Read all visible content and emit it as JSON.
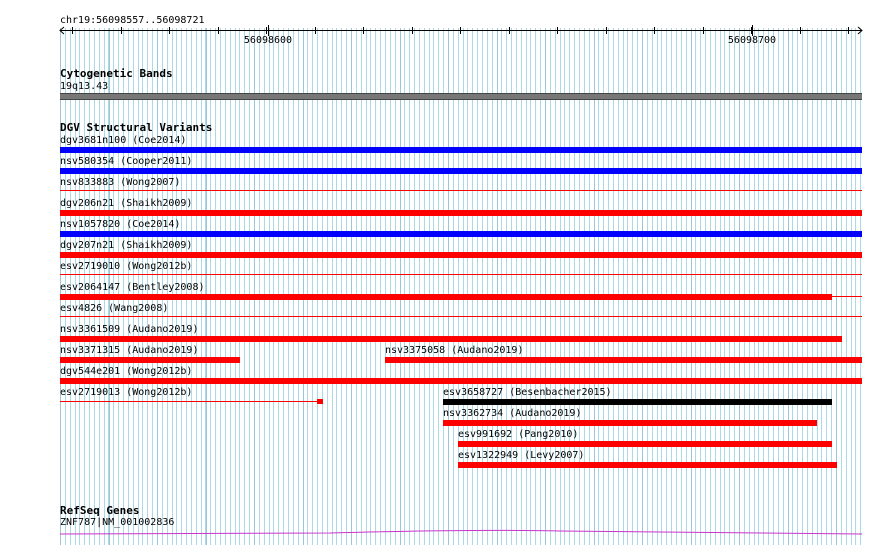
{
  "ruler": {
    "region_label": "chr19:56098557..56098721",
    "ticks": [
      {
        "label": "56098600"
      },
      {
        "label": "56098700"
      }
    ]
  },
  "cytobands": {
    "title": "Cytogenetic Bands",
    "band": "19q13.43",
    "color": "#777777"
  },
  "dgv": {
    "title": "DGV Structural Variants",
    "colors": {
      "gain": "#0000ff",
      "loss": "#ff0000",
      "complex": "#000000"
    },
    "features": [
      {
        "label": "dgv3681n100 (Coe2014)",
        "type": "gain"
      },
      {
        "label": "nsv580354 (Cooper2011)",
        "type": "gain"
      },
      {
        "label": "nsv833883 (Wong2007)",
        "type": "loss"
      },
      {
        "label": "dgv206n21 (Shaikh2009)",
        "type": "loss"
      },
      {
        "label": "nsv1057820 (Coe2014)",
        "type": "gain"
      },
      {
        "label": "dgv207n21 (Shaikh2009)",
        "type": "loss"
      },
      {
        "label": "esv2719010 (Wong2012b)",
        "type": "loss"
      },
      {
        "label": "esv2064147 (Bentley2008)",
        "type": "loss"
      },
      {
        "label": "esv4826 (Wang2008)",
        "type": "loss"
      },
      {
        "label": "nsv3361509 (Audano2019)",
        "type": "loss"
      },
      {
        "label": "nsv3371315 (Audano2019)",
        "type": "loss"
      },
      {
        "label": "nsv3375058 (Audano2019)",
        "type": "loss"
      },
      {
        "label": "dgv544e201 (Wong2012b)",
        "type": "loss"
      },
      {
        "label": "esv2719013 (Wong2012b)",
        "type": "loss"
      },
      {
        "label": "esv3658727 (Besenbacher2015)",
        "type": "complex"
      },
      {
        "label": "nsv3362734 (Audano2019)",
        "type": "loss"
      },
      {
        "label": "esv991692 (Pang2010)",
        "type": "loss"
      },
      {
        "label": "esv1322949 (Levy2007)",
        "type": "loss"
      }
    ]
  },
  "refseq": {
    "title": "RefSeq Genes",
    "gene": "ZNF787|NM_001002836",
    "color": "#cc33cc"
  }
}
